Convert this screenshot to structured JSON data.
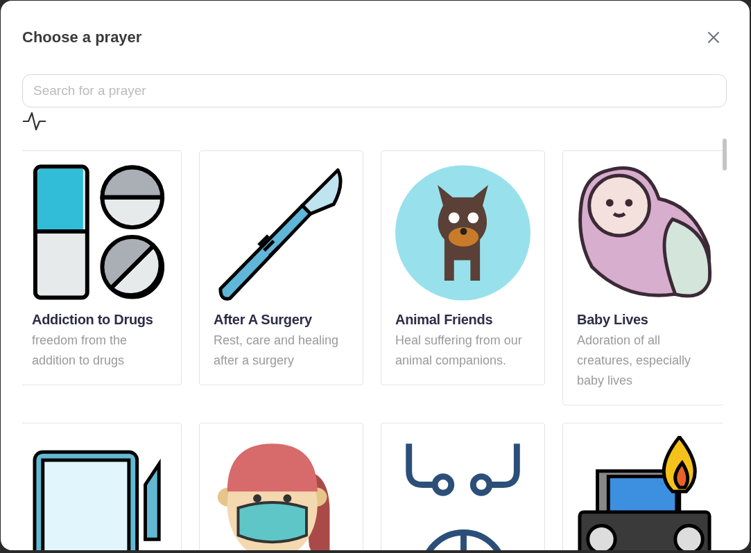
{
  "dialog": {
    "title": "Choose a prayer"
  },
  "search": {
    "placeholder": "Search for a prayer"
  },
  "prayers": [
    {
      "title": "Addiction to Drugs",
      "description": "freedom from the addition to drugs"
    },
    {
      "title": "After A Surgery",
      "description": "Rest, care and healing after a surgery"
    },
    {
      "title": "Animal Friends",
      "description": "Heal suffering from our animal companions."
    },
    {
      "title": "Baby Lives",
      "description": "Adoration of all creatures, especially baby lives"
    }
  ]
}
